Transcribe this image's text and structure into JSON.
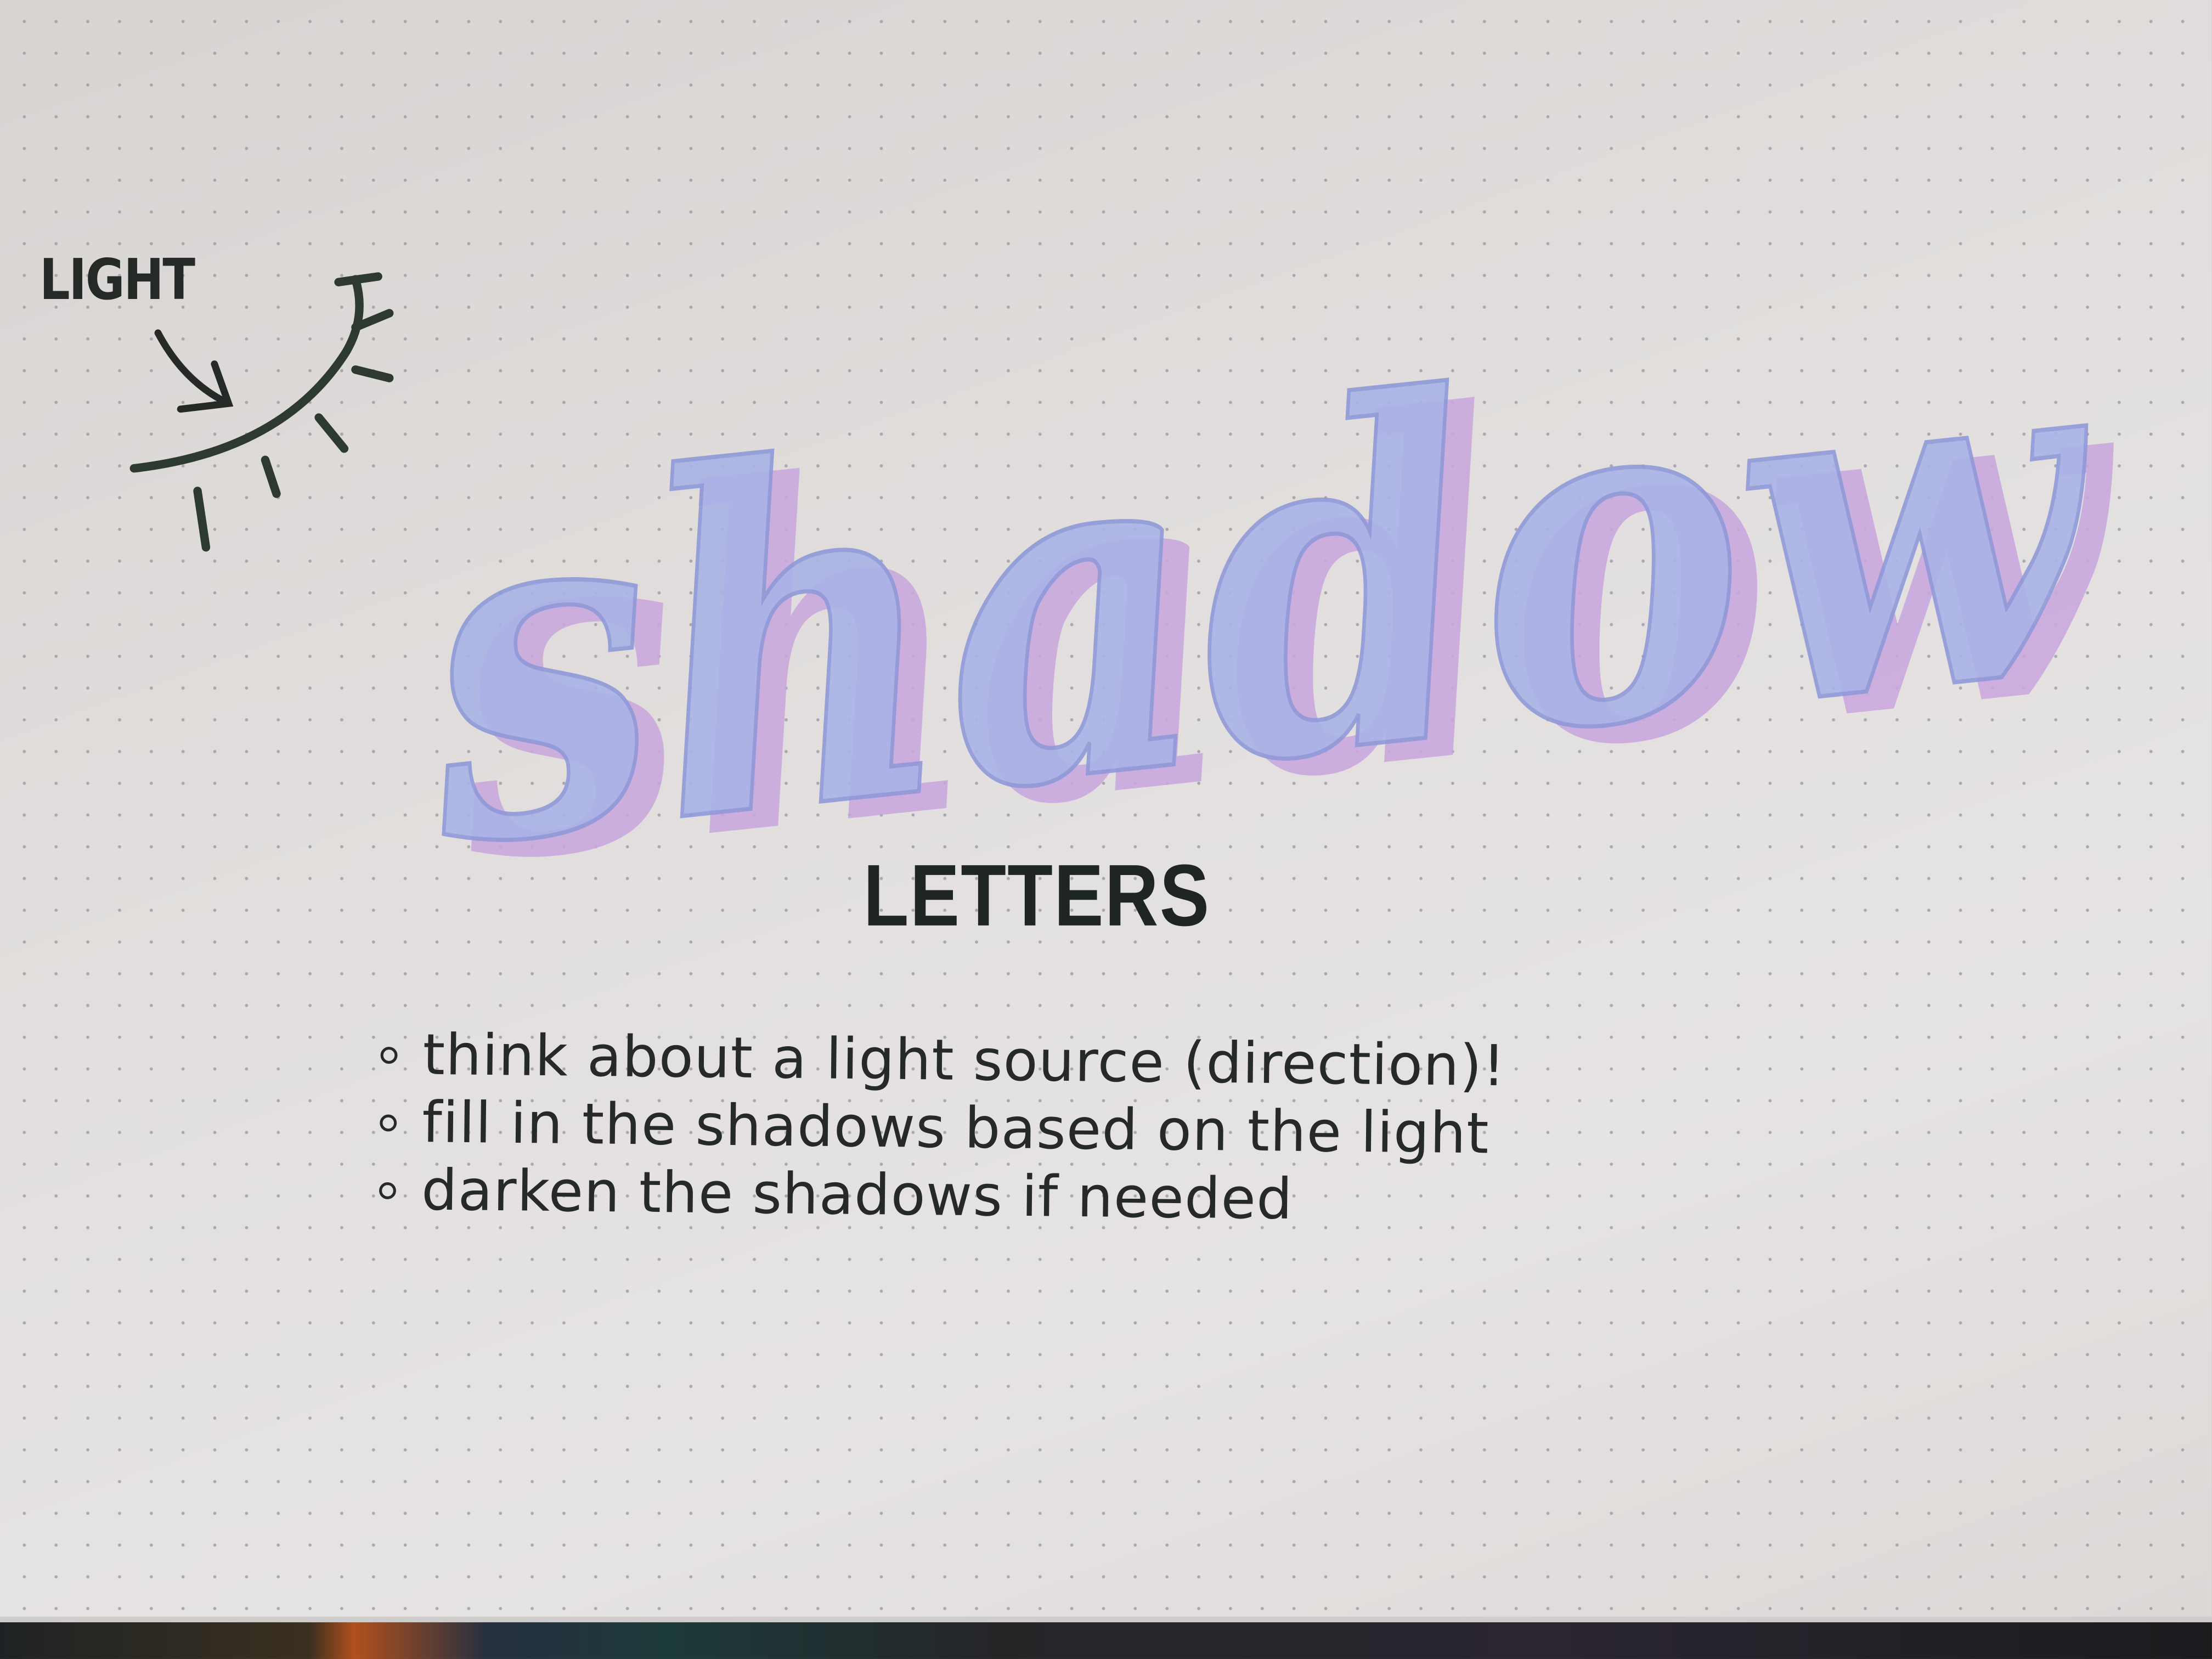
{
  "drawing": {
    "light_label": "LIGHT",
    "script_word": "shadow",
    "title": "LETTERS",
    "bullets": [
      "think about a light source (direction)!",
      "fill in the shadows based on the light",
      "darken the shadows if needed"
    ],
    "icons": [
      "arrow-icon",
      "sun-icon"
    ]
  },
  "colors": {
    "paper": "#e2dfde",
    "ink": "#262a27",
    "letter_fill": "#a9b3e6",
    "letter_shadow": "#c9a6de"
  }
}
